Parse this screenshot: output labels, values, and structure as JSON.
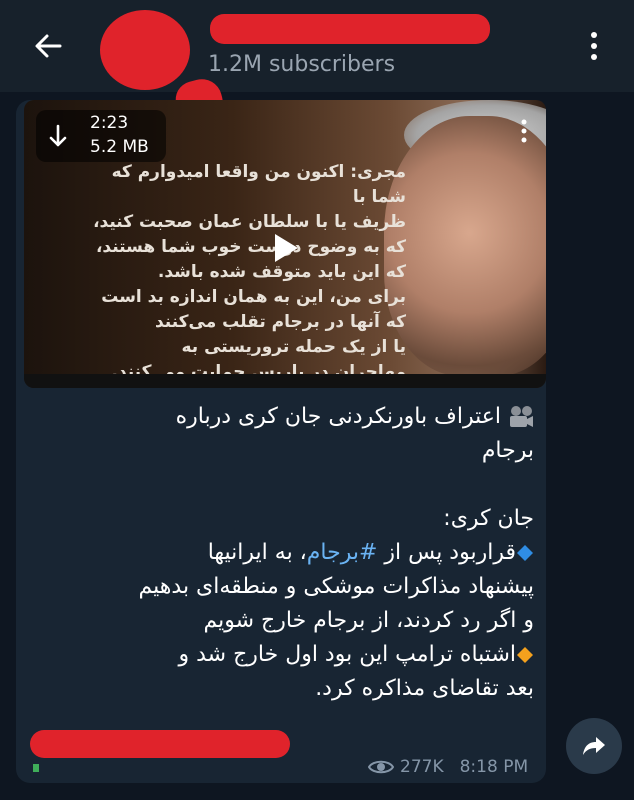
{
  "header": {
    "subscribers": "1.2M subscribers"
  },
  "video": {
    "duration": "2:23",
    "size": "5.2 MB",
    "overlay_text": [
      "مجری: اکنون من واقعا امیدوارم که شما با",
      "ظریف یا با سلطان عمان صحبت کنید،",
      "که به وضوح دوست خوب شما هستند،",
      "که این باید متوقف شده باشد.",
      "برای من، این به همان اندازه بد است",
      "که آنها در برجام تقلب می‌کنند",
      "یا از یک حمله تروریستی به",
      "مهاجران در پاریس حمایت می کنند."
    ]
  },
  "message": {
    "title_line1": "اعتراف باورنکردنی جان کری درباره",
    "title_line2": "برجام",
    "speaker": "جان کری:",
    "b1_a": "قراربود پس از ",
    "b1_hashtag": "#برجام",
    "b1_b": "، به ایرانیها",
    "b1_line2": "پیشنهاد مذاکرات موشکی و منطقه‌ای بدهیم",
    "b1_line3": "و اگر رد کردند، از برجام خارج شویم",
    "b2_line1": "اشتباه ترامپ این بود اول خارج شد و",
    "b2_line2": "بعد تقاضای مذاکره کرد."
  },
  "footer": {
    "views": "277K",
    "time": "8:18 PM"
  },
  "icons": {
    "back": "arrow-left-icon",
    "menu": "more-vertical-icon",
    "download": "arrow-down-icon",
    "play": "play-icon",
    "film": "film-camera-icon",
    "bullet1": "blue-diamond-icon",
    "bullet2": "orange-diamond-icon",
    "views": "eye-icon",
    "share": "share-icon"
  },
  "colors": {
    "background": "#0e1621",
    "header": "#17212b",
    "bubble": "#182533",
    "hashtag": "#6ab3f3",
    "meta": "#8596a8",
    "redaction": "#e0232b"
  }
}
